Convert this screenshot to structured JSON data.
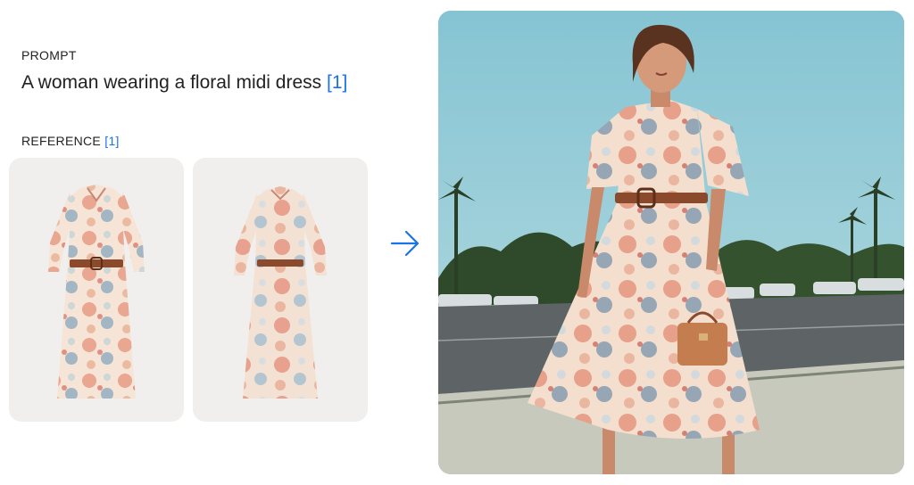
{
  "prompt": {
    "heading": "PROMPT",
    "text": "A woman wearing a floral midi dress",
    "ref_tag": "[1]"
  },
  "reference": {
    "heading": "REFERENCE",
    "ref_tag": "[1]",
    "images": [
      {
        "subject": "floral midi dress with belt, front view"
      },
      {
        "subject": "floral midi dress with belt, alternate view"
      }
    ]
  },
  "arrow_icon": "arrow-right-icon",
  "result_image": {
    "subject": "woman wearing floral midi dress on a sunny street with palm trees"
  },
  "colors": {
    "accent": "#1a73e8",
    "card_bg": "#f1efed",
    "sky": "#8dc6d4",
    "text": "#222222"
  }
}
